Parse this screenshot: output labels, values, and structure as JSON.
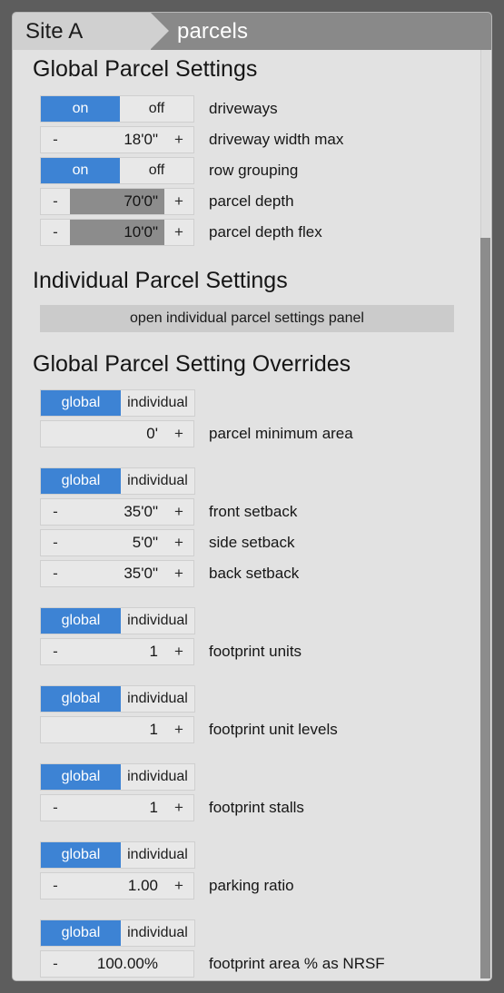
{
  "breadcrumb": {
    "site_label": "Site A",
    "current_label": "parcels"
  },
  "sections": {
    "global_parcel_settings": "Global Parcel Settings",
    "individual_parcel_settings": "Individual Parcel Settings",
    "global_parcel_setting_overrides": "Global Parcel Setting Overrides"
  },
  "buttons": {
    "open_individual_panel": "open individual parcel settings panel"
  },
  "toggle_options": {
    "on": "on",
    "off": "off",
    "global": "global",
    "individual": "individual"
  },
  "stepper_glyphs": {
    "minus": "-",
    "plus": "+"
  },
  "colors": {
    "accent_blue": "#3d83d4",
    "breadcrumb_bar": "#898989",
    "breadcrumb_site": "#d0d0d0",
    "panel_bg": "#e2e2e2",
    "field_bg": "#e8e8e8",
    "highlight_gray": "#8c8c8c",
    "button_gray": "#cbcbcb",
    "outer_bg": "#5d5d5d"
  },
  "global_settings": [
    {
      "kind": "toggle",
      "label": "driveways",
      "selected": "on",
      "left": "on",
      "right": "off"
    },
    {
      "kind": "stepper",
      "label": "driveway width max",
      "value": "18'0\"",
      "has_minus": true,
      "has_plus": true,
      "highlighted": false
    },
    {
      "kind": "toggle",
      "label": "row grouping",
      "selected": "on",
      "left": "on",
      "right": "off"
    },
    {
      "kind": "stepper",
      "label": "parcel depth",
      "value": "70'0\"",
      "has_minus": true,
      "has_plus": true,
      "highlighted": true
    },
    {
      "kind": "stepper",
      "label": "parcel depth flex",
      "value": "10'0\"",
      "has_minus": true,
      "has_plus": true,
      "highlighted": true
    }
  ],
  "overrides": [
    {
      "scope_selected": "global",
      "rows": [
        {
          "label": "parcel minimum area",
          "value": "0'",
          "has_minus": false,
          "has_plus": true,
          "highlighted": false
        }
      ]
    },
    {
      "scope_selected": "global",
      "rows": [
        {
          "label": "front setback",
          "value": "35'0\"",
          "has_minus": true,
          "has_plus": true,
          "highlighted": false
        },
        {
          "label": "side setback",
          "value": "5'0\"",
          "has_minus": true,
          "has_plus": true,
          "highlighted": false
        },
        {
          "label": "back setback",
          "value": "35'0\"",
          "has_minus": true,
          "has_plus": true,
          "highlighted": false
        }
      ]
    },
    {
      "scope_selected": "global",
      "rows": [
        {
          "label": "footprint units",
          "value": "1",
          "has_minus": true,
          "has_plus": true,
          "highlighted": false
        }
      ]
    },
    {
      "scope_selected": "global",
      "rows": [
        {
          "label": "footprint unit levels",
          "value": "1",
          "has_minus": false,
          "has_plus": true,
          "highlighted": false
        }
      ]
    },
    {
      "scope_selected": "global",
      "rows": [
        {
          "label": "footprint stalls",
          "value": "1",
          "has_minus": true,
          "has_plus": true,
          "highlighted": false
        }
      ]
    },
    {
      "scope_selected": "global",
      "rows": [
        {
          "label": "parking ratio",
          "value": "1.00",
          "has_minus": true,
          "has_plus": true,
          "highlighted": false
        }
      ]
    },
    {
      "scope_selected": "global",
      "rows": [
        {
          "label": "footprint area % as NRSF",
          "value": "100.00%",
          "has_minus": true,
          "has_plus": false,
          "highlighted": false
        }
      ]
    }
  ]
}
